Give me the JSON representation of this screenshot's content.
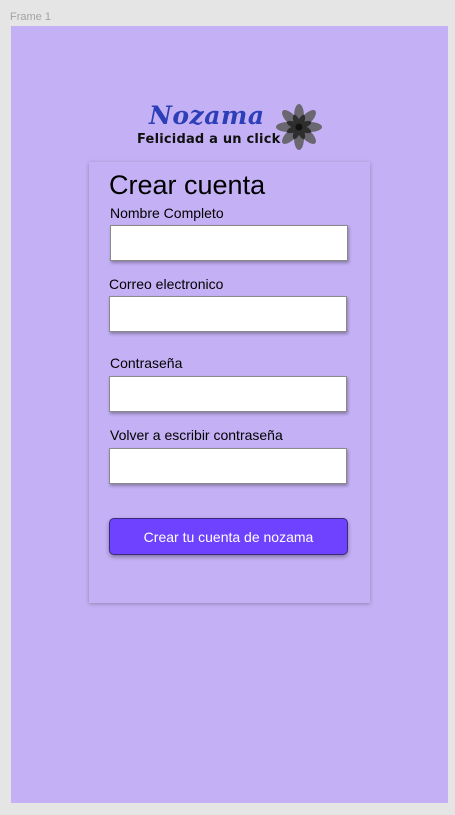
{
  "frame": {
    "label": "Frame 1"
  },
  "logo": {
    "title": "Nozama",
    "tagline": "Felicidad a un click",
    "icon": "flower-icon"
  },
  "form": {
    "title": "Crear cuenta",
    "fields": [
      {
        "label": "Nombre Completo",
        "value": "",
        "placeholder": ""
      },
      {
        "label": "Correo electronico",
        "value": "",
        "placeholder": ""
      },
      {
        "label": "Contraseña",
        "value": "",
        "placeholder": ""
      },
      {
        "label": "Volver a escribir contraseña",
        "value": "",
        "placeholder": ""
      }
    ],
    "submit_label": "Crear tu cuenta de nozama"
  },
  "colors": {
    "background": "#c4b0f4",
    "accent": "#6f42ff",
    "logo_text": "#2d3fb8"
  }
}
